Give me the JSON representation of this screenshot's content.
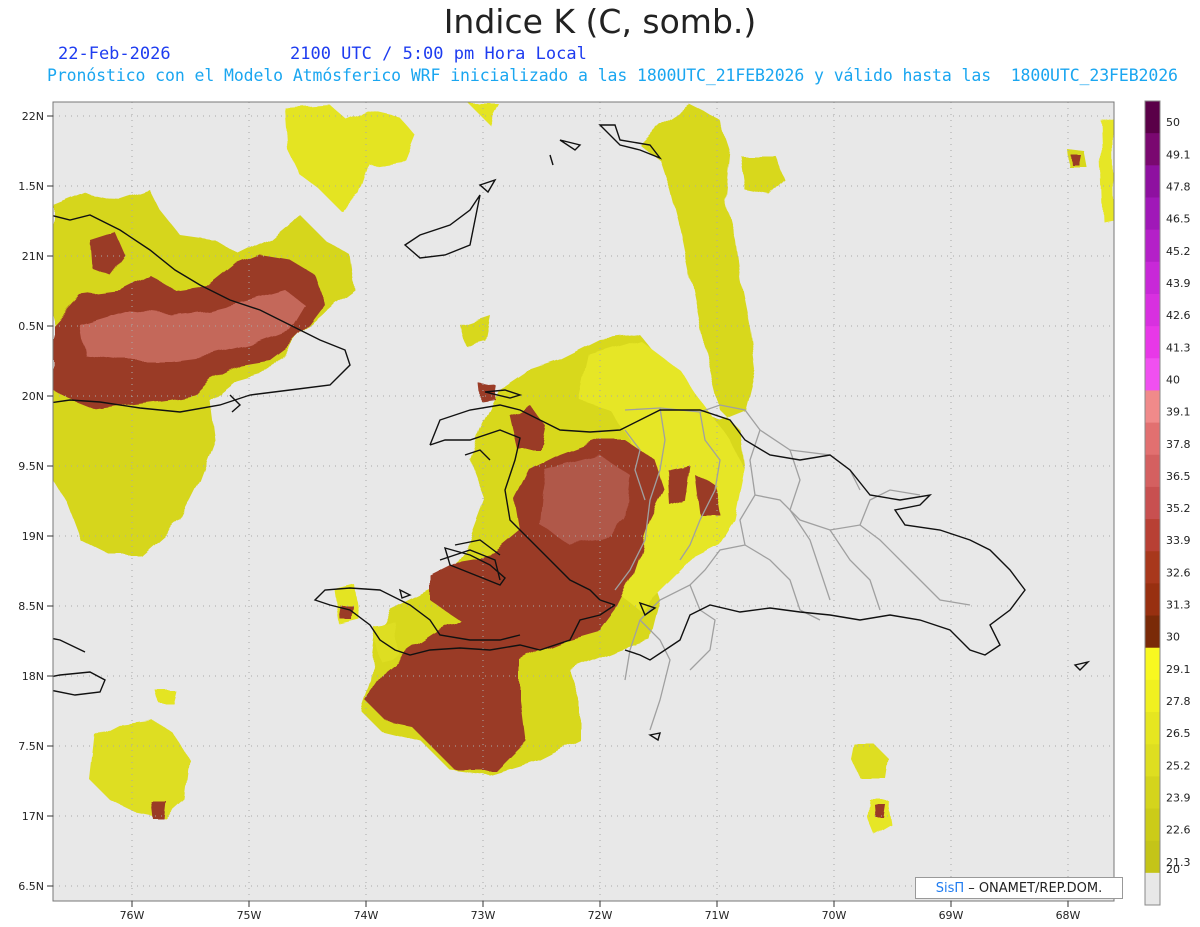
{
  "header": {
    "title": "Indice K (C, somb.)",
    "date": "22-Feb-2026",
    "time_label": "2100 UTC / 5:00 pm Hora Local",
    "forecast_line": "Pronóstico con el Modelo Atmósferico WRF inicializado a las 1800UTC_21FEB2026 y válido hasta las  1800UTC_23FEB2026"
  },
  "axes": {
    "lat_labels": [
      "22N",
      "1.5N",
      "21N",
      "0.5N",
      "20N",
      "9.5N",
      "19N",
      "8.5N",
      "18N",
      "7.5N",
      "17N",
      "6.5N"
    ],
    "lon_labels": [
      "76W",
      "75W",
      "74W",
      "73W",
      "72W",
      "71W",
      "70W",
      "69W",
      "68W"
    ]
  },
  "colorbar": {
    "labels": [
      "50",
      "49.1",
      "47.8",
      "46.5",
      "45.2",
      "43.9",
      "42.6",
      "41.3",
      "40",
      "39.1",
      "37.8",
      "36.5",
      "35.2",
      "33.9",
      "32.6",
      "31.3",
      "30",
      "29.1",
      "27.8",
      "26.5",
      "25.2",
      "23.9",
      "22.6",
      "21.3",
      "20"
    ],
    "colors": [
      "#5a0048",
      "#7a0870",
      "#8e10a0",
      "#a018b8",
      "#b420c8",
      "#c828d8",
      "#d830e0",
      "#e838e8",
      "#f050f0",
      "#f08a8a",
      "#e27070",
      "#d46060",
      "#c85050",
      "#b84034",
      "#a8381c",
      "#983010",
      "#7a2a08",
      "#f8f820",
      "#f0f020",
      "#e6e620",
      "#dede20",
      "#d4d41c",
      "#cccc18",
      "#c4c418",
      "#e8e8e8"
    ]
  },
  "credit": {
    "brand": "SisΠ",
    "text": "– ONAMET/REP.DOM."
  }
}
